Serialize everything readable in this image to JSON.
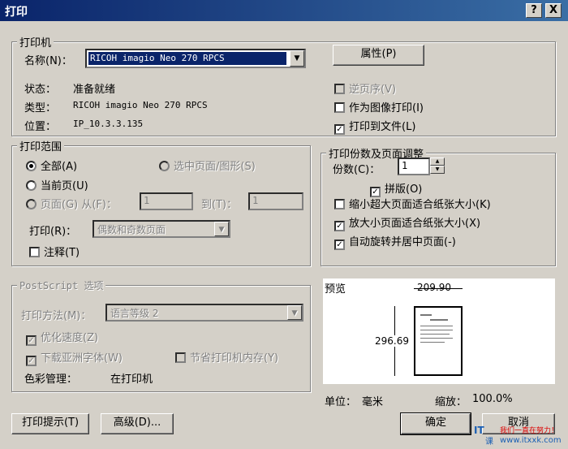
{
  "window": {
    "title": "打印",
    "help_btn": "?",
    "close_btn": "X"
  },
  "printer": {
    "legend": "打印机",
    "name_label": "名称(N)：",
    "name_value": "RICOH imagio Neo 270 RPCS",
    "properties_btn": "属性(P)",
    "status_label": "状态：",
    "status_value": "准备就绪",
    "type_label": "类型：",
    "type_value": "RICOH imagio Neo 270 RPCS",
    "location_label": "位置：",
    "location_value": "IP_10.3.3.135",
    "reverse_order": {
      "label": "逆页序(V)",
      "checked": false,
      "enabled": false
    },
    "print_as_image": {
      "label": "作为图像打印(I)",
      "checked": false,
      "enabled": true
    },
    "print_to_file": {
      "label": "打印到文件(L)",
      "checked": true,
      "enabled": true
    }
  },
  "range": {
    "legend": "打印范围",
    "all": "全部(A)",
    "selection": "选中页面/图形(S)",
    "current": "当前页(U)",
    "pages": "页面(G) 从(F)：",
    "from_value": "1",
    "to_label": "到(T)：",
    "to_value": "1",
    "print_label": "打印(R)：",
    "print_value": "偶数和奇数页面",
    "annotations": "注释(T)"
  },
  "copies": {
    "legend": "打印份数及页面调整",
    "count_label": "份数(C)：",
    "count_value": "1",
    "collate": "拼版(O)",
    "shrink_oversized": "缩小超大页面适合纸张大小(K)",
    "expand_small": "放大小页面适合纸张大小(X)",
    "auto_rotate": "自动旋转并居中页面(-)"
  },
  "postscript": {
    "legend": "PostScript 选项",
    "method_label": "打印方法(M)：",
    "method_value": "语言等级 2",
    "optimize_speed": "优化速度(Z)",
    "download_asian": "下载亚洲字体(W)",
    "save_memory": "节省打印机内存(Y)",
    "color_label": "色彩管理：",
    "color_value": "在打印机"
  },
  "preview": {
    "label": "预览",
    "width": "209.90",
    "height": "296.69",
    "unit_label": "单位：",
    "unit_value": "毫米",
    "zoom_label": "缩放：",
    "zoom_value": "100.0%"
  },
  "buttons": {
    "tips": "打印提示(T)",
    "advanced": "高级(D)...",
    "ok": "确定",
    "cancel": "取消"
  },
  "watermark": {
    "logo": "IT",
    "sub": "课",
    "slogan": "我们一直在努力！",
    "site": "www.itxxk.com"
  }
}
